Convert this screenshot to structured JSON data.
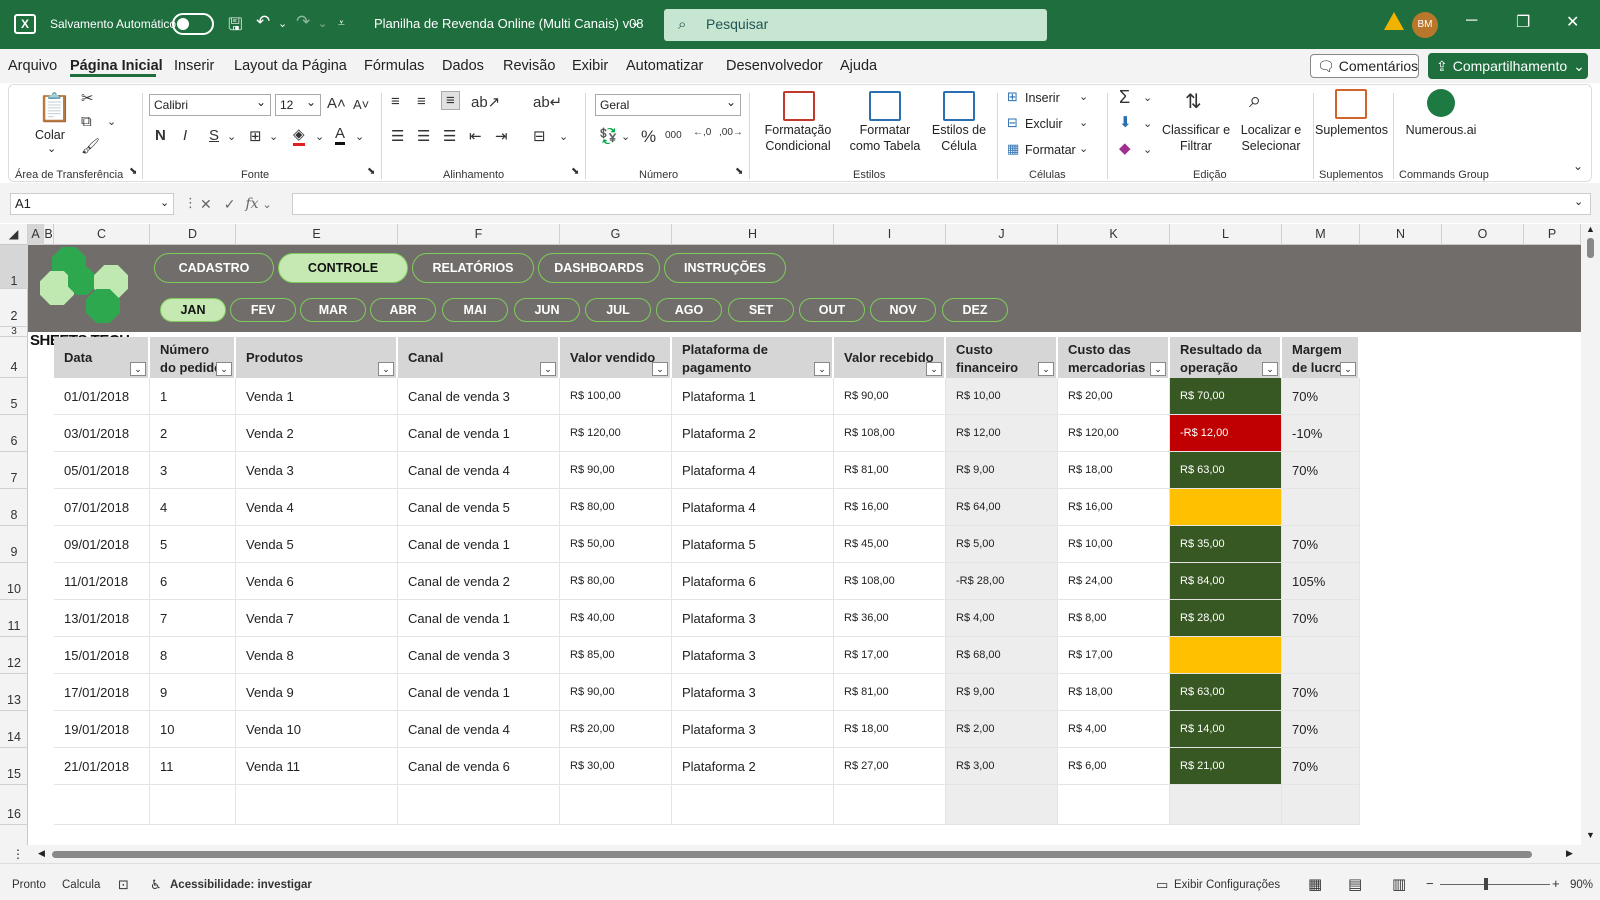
{
  "titlebar": {
    "autosave_label": "Salvamento Automático",
    "doc_title": "Planilha de Revenda Online (Multi Canais) v08",
    "search_placeholder": "Pesquisar",
    "avatar": "BM"
  },
  "menu": {
    "tabs": [
      "Arquivo",
      "Página Inicial",
      "Inserir",
      "Layout da Página",
      "Fórmulas",
      "Dados",
      "Revisão",
      "Exibir",
      "Automatizar",
      "Desenvolvedor",
      "Ajuda"
    ],
    "comments": "Comentários",
    "share": "Compartilhamento"
  },
  "ribbon": {
    "clipboard": {
      "paste": "Colar",
      "label": "Área de Transferência"
    },
    "font": {
      "name": "Calibri",
      "size": "12",
      "bold": "N",
      "italic": "I",
      "underline": "S",
      "label": "Fonte"
    },
    "alignment": {
      "label": "Alinhamento"
    },
    "number": {
      "format": "Geral",
      "label": "Número"
    },
    "styles": {
      "cond_format": "Formatação Condicional",
      "format_table": "Formatar como Tabela",
      "cell_styles": "Estilos de Célula",
      "label": "Estilos"
    },
    "cells": {
      "insert": "Inserir",
      "delete": "Excluir",
      "format": "Formatar",
      "label": "Células"
    },
    "editing": {
      "sort": "Classificar e Filtrar",
      "find": "Localizar e Selecionar",
      "label": "Edição"
    },
    "addins": {
      "addins": "Suplementos",
      "label": "Suplementos"
    },
    "commands": {
      "numerous": "Numerous.ai",
      "label": "Commands Group"
    }
  },
  "formula_bar": {
    "namebox": "A1",
    "fx": "fx"
  },
  "columns": [
    "A",
    "B",
    "C",
    "D",
    "E",
    "F",
    "G",
    "H",
    "I",
    "J",
    "K",
    "L",
    "M",
    "N",
    "O",
    "P"
  ],
  "rows": [
    "1",
    "2",
    "3",
    "4",
    "5",
    "6",
    "7",
    "8",
    "9",
    "10",
    "11",
    "12",
    "13",
    "14",
    "15",
    "16"
  ],
  "nav": {
    "buttons": [
      "CADASTRO",
      "CONTROLE",
      "RELATÓRIOS",
      "DASHBOARDS",
      "INSTRUÇÕES"
    ],
    "months": [
      "JAN",
      "FEV",
      "MAR",
      "ABR",
      "MAI",
      "JUN",
      "JUL",
      "AGO",
      "SET",
      "OUT",
      "NOV",
      "DEZ"
    ],
    "logo": "SHEETS TECH"
  },
  "table": {
    "headers": [
      "Data",
      "Número do pedido",
      "Produtos",
      "Canal",
      "Valor vendido",
      "Plataforma de pagamento",
      "Valor recebido",
      "Custo financeiro",
      "Custo das mercadorias",
      "Resultado da operação",
      "Margem de lucro"
    ],
    "rows": [
      [
        "01/01/2018",
        "1",
        "Venda 1",
        "Canal de venda 3",
        "R$ 100,00",
        "Plataforma 1",
        "R$ 90,00",
        "R$ 10,00",
        "R$ 20,00",
        "R$ 70,00",
        "70%"
      ],
      [
        "03/01/2018",
        "2",
        "Venda 2",
        "Canal de venda 1",
        "R$ 120,00",
        "Plataforma 2",
        "R$ 108,00",
        "R$ 12,00",
        "R$ 120,00",
        "-R$ 12,00",
        "-10%"
      ],
      [
        "05/01/2018",
        "3",
        "Venda 3",
        "Canal de venda 4",
        "R$ 90,00",
        "Plataforma 4",
        "R$ 81,00",
        "R$ 9,00",
        "R$ 18,00",
        "R$ 63,00",
        "70%"
      ],
      [
        "07/01/2018",
        "4",
        "Venda 4",
        "Canal de venda 5",
        "R$ 80,00",
        "Plataforma 4",
        "R$ 16,00",
        "R$ 64,00",
        "R$ 16,00",
        "",
        ""
      ],
      [
        "09/01/2018",
        "5",
        "Venda 5",
        "Canal de venda 1",
        "R$ 50,00",
        "Plataforma 5",
        "R$ 45,00",
        "R$ 5,00",
        "R$ 10,00",
        "R$ 35,00",
        "70%"
      ],
      [
        "11/01/2018",
        "6",
        "Venda 6",
        "Canal de venda 2",
        "R$ 80,00",
        "Plataforma 6",
        "R$ 108,00",
        "-R$ 28,00",
        "R$ 24,00",
        "R$ 84,00",
        "105%"
      ],
      [
        "13/01/2018",
        "7",
        "Venda 7",
        "Canal de venda 1",
        "R$ 40,00",
        "Plataforma 3",
        "R$ 36,00",
        "R$ 4,00",
        "R$ 8,00",
        "R$ 28,00",
        "70%"
      ],
      [
        "15/01/2018",
        "8",
        "Venda 8",
        "Canal de venda 3",
        "R$ 85,00",
        "Plataforma 3",
        "R$ 17,00",
        "R$ 68,00",
        "R$ 17,00",
        "",
        ""
      ],
      [
        "17/01/2018",
        "9",
        "Venda 9",
        "Canal de venda 1",
        "R$ 90,00",
        "Plataforma 3",
        "R$ 81,00",
        "R$ 9,00",
        "R$ 18,00",
        "R$ 63,00",
        "70%"
      ],
      [
        "19/01/2018",
        "10",
        "Venda 10",
        "Canal de venda 4",
        "R$ 20,00",
        "Plataforma 3",
        "R$ 18,00",
        "R$ 2,00",
        "R$ 4,00",
        "R$ 14,00",
        "70%"
      ],
      [
        "21/01/2018",
        "11",
        "Venda 11",
        "Canal de venda 6",
        "R$ 30,00",
        "Plataforma 2",
        "R$ 27,00",
        "R$ 3,00",
        "R$ 6,00",
        "R$ 21,00",
        "70%"
      ]
    ]
  },
  "status": {
    "ready": "Pronto",
    "calc": "Calcula",
    "accessibility": "Acessibilidade: investigar",
    "display": "Exibir Configurações",
    "zoom": "90%"
  },
  "colors": {
    "excel_green": "#1e6e3e",
    "banner": "#716d6b",
    "positive": "#375723",
    "negative": "#c00000",
    "neutral": "#ffc000"
  }
}
